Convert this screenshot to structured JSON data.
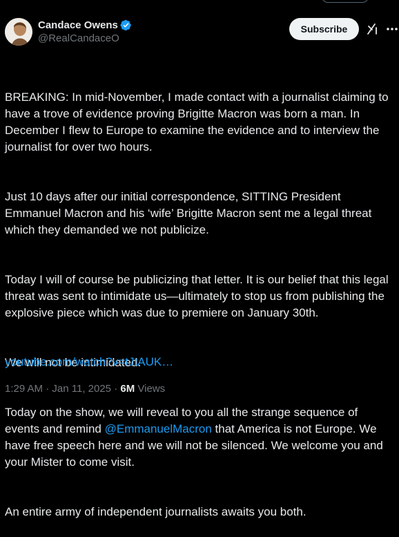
{
  "author": {
    "display_name": "Candace Owens",
    "handle": "@RealCandaceO",
    "verified": true,
    "avatar_icon": "profile-avatar"
  },
  "actions": {
    "subscribe_label": "Subscribe",
    "grok_icon": "grok-icon",
    "more_icon": "more-options-icon"
  },
  "tweet": {
    "p1": "BREAKING: In mid-November, I made contact with a journalist claiming to have a trove of evidence proving Brigitte Macron was born a man. In December I flew to Europe to examine the evidence and to interview the journalist for over two hours.",
    "p2": "Just 10 days after our initial correspondence, SITTING President Emmanuel Macron and his ‘wife’ Brigitte Macron sent me a legal threat which they demanded we not publicize.",
    "p3": "Today I will of course be publicizing that letter. It is our belief that this legal threat was sent to intimidate us—ultimately to stop us from publishing the explosive piece which was due to premiere on January 30th.",
    "p4": "We will not be intimidated.",
    "p5_before": "Today on the show, we will reveal to you all the strange sequence of events and remind ",
    "p5_mention": "@EmmanuelMacron",
    "p5_after": " that America is not Europe. We have free speech here and we will not be silenced. We welcome you and your Mister to come visit.",
    "p6": "An entire army of independent journalists awaits you both.",
    "link": "youtube.com/watch?v=tJtAUK…"
  },
  "meta": {
    "time": "1:29 AM",
    "separator1": " · ",
    "date": "Jan 11, 2025",
    "separator2": " · ",
    "views_count": "6M",
    "views_label": " Views"
  },
  "colors": {
    "background": "#000000",
    "text": "#e7e9ea",
    "secondary": "#71767b",
    "link": "#1d9bf0",
    "subscribe_bg": "#eff3f4"
  }
}
